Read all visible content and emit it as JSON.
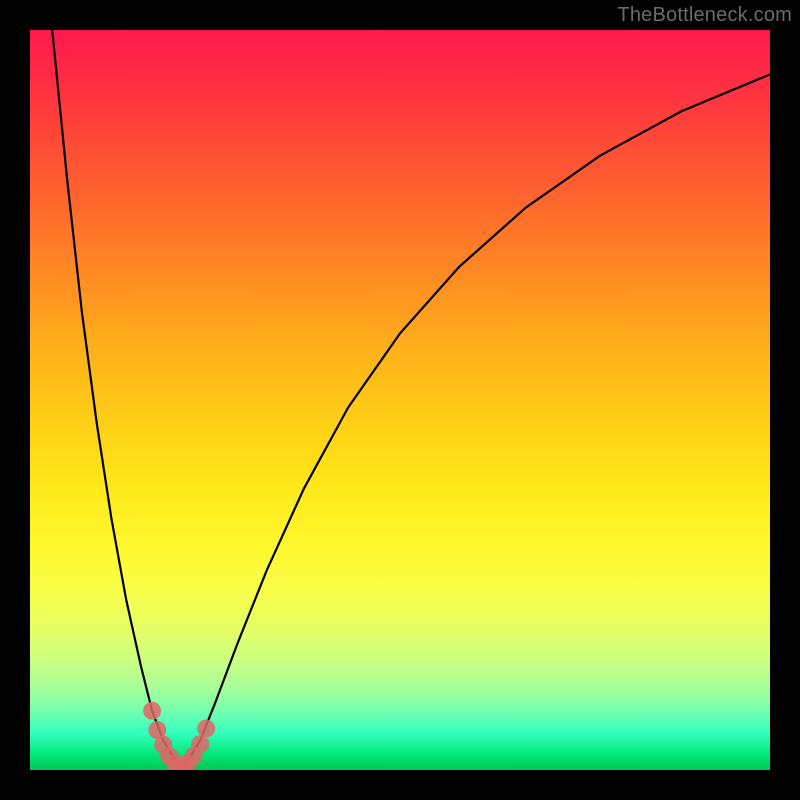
{
  "watermark": "TheBottleneck.com",
  "chart_data": {
    "type": "line",
    "title": "",
    "xlabel": "",
    "ylabel": "",
    "xlim": [
      0,
      100
    ],
    "ylim": [
      0,
      100
    ],
    "series": [
      {
        "name": "bottleneck-curve",
        "x": [
          3,
          5,
          7,
          9,
          11,
          13,
          15,
          16.5,
          18,
          19.5,
          20.5,
          21.5,
          23,
          25,
          28,
          32,
          37,
          43,
          50,
          58,
          67,
          77,
          88,
          100
        ],
        "y": [
          100,
          80,
          62,
          47,
          34,
          23,
          14,
          8,
          4,
          1.5,
          0.5,
          1.5,
          4,
          9,
          17,
          27,
          38,
          49,
          59,
          68,
          76,
          83,
          89,
          94
        ]
      }
    ],
    "markers": {
      "name": "highlight-points",
      "color": "#e06666",
      "x": [
        16.5,
        17.2,
        18.0,
        18.8,
        19.6,
        20.5,
        21.3,
        22.1,
        23.0,
        23.8
      ],
      "y": [
        8.0,
        5.4,
        3.4,
        1.9,
        0.9,
        0.5,
        0.9,
        1.9,
        3.5,
        5.6
      ]
    },
    "gradient_stops": [
      {
        "pct": 0,
        "color": "#ff1a4d"
      },
      {
        "pct": 24,
        "color": "#ff6a2c"
      },
      {
        "pct": 54,
        "color": "#ffd216"
      },
      {
        "pct": 76,
        "color": "#f8ff4a"
      },
      {
        "pct": 92,
        "color": "#73ffad"
      },
      {
        "pct": 100,
        "color": "#00c853"
      }
    ]
  }
}
